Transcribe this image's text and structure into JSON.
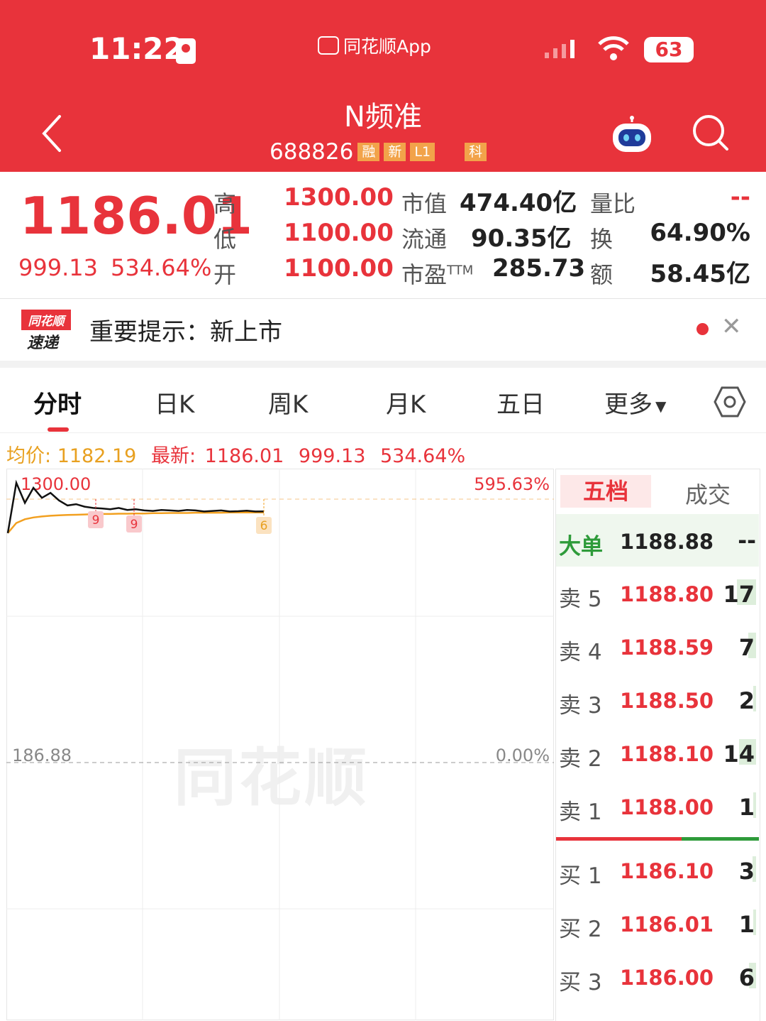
{
  "status_bar": {
    "time": "11:22",
    "app_label": "同花顺App",
    "battery": "63"
  },
  "header": {
    "stock_name": "N频准",
    "stock_code": "688826",
    "tags": [
      "融",
      "新",
      "L1",
      "科"
    ]
  },
  "quote": {
    "price": "1186.01",
    "change": "999.13",
    "change_pct": "534.64%",
    "high_label": "高",
    "high": "1300.00",
    "low_label": "低",
    "low": "1100.00",
    "open_label": "开",
    "open": "1100.00",
    "mcap_label": "市值",
    "mcap": "474.40亿",
    "float_label": "流通",
    "float_cap": "90.35亿",
    "pe_label": "市盈",
    "pe_sup": "TTM",
    "pe": "285.73",
    "vol_ratio_label": "量比",
    "vol_ratio": "--",
    "turnover_label": "换",
    "turnover": "64.90%",
    "amount_label": "额",
    "amount": "58.45亿"
  },
  "notice": {
    "logo_line1": "同花顺",
    "logo_line2": "速递",
    "text": "重要提示：新上市"
  },
  "tabs": [
    "分时",
    "日K",
    "周K",
    "月K",
    "五日",
    "更多"
  ],
  "info_line": {
    "avg_label": "均价:",
    "avg": "1182.19",
    "latest_label": "最新:",
    "latest": "1186.01",
    "change": "999.13",
    "change_pct": "534.64%"
  },
  "chart_data": {
    "type": "line",
    "series": [
      {
        "values": [
          1100,
          1300,
          1220,
          1280,
          1240,
          1260,
          1230,
          1210,
          1215,
          1205,
          1200,
          1198,
          1195,
          1200,
          1192,
          1195,
          1190,
          1188,
          1192,
          1190,
          1188,
          1192,
          1190,
          1186,
          1188,
          1190,
          1186,
          1187,
          1189,
          1186,
          1186.01
        ]
      },
      {
        "values": [
          1100,
          1140,
          1155,
          1162,
          1166,
          1169,
          1171,
          1172,
          1173,
          1174,
          1175,
          1176,
          1176,
          1177,
          1177,
          1178,
          1178,
          1179,
          1179,
          1180,
          1180,
          1180,
          1181,
          1181,
          1181,
          1181,
          1182,
          1182,
          1182,
          1182,
          1182.19
        ]
      }
    ],
    "y_top_label": "1300.00",
    "y_mid_label": "186.88",
    "pct_top_label": "595.63%",
    "pct_mid_label": "0.00%",
    "markers": [
      "9",
      "9",
      "6"
    ],
    "watermark": "同花顺",
    "colors": {
      "price": "#111111",
      "avg": "#F2A020",
      "high_segment": "#E8333B"
    }
  },
  "orderbook": {
    "tab_active": "五档",
    "tab_other": "成交",
    "big_order_label": "大单",
    "big_order_price": "1188.88",
    "big_order_vol": "--",
    "asks": [
      {
        "label": "卖 5",
        "price": "1188.80",
        "vol": "17",
        "bar_pct": 45
      },
      {
        "label": "卖 4",
        "price": "1188.59",
        "vol": "7",
        "bar_pct": 18
      },
      {
        "label": "卖 3",
        "price": "1188.50",
        "vol": "2",
        "bar_pct": 6
      },
      {
        "label": "卖 2",
        "price": "1188.10",
        "vol": "14",
        "bar_pct": 40
      },
      {
        "label": "卖 1",
        "price": "1188.00",
        "vol": "1",
        "bar_pct": 3
      }
    ],
    "bids": [
      {
        "label": "买 1",
        "price": "1186.10",
        "vol": "3",
        "bar_pct": 8
      },
      {
        "label": "买 2",
        "price": "1186.01",
        "vol": "1",
        "bar_pct": 3
      },
      {
        "label": "买 3",
        "price": "1186.00",
        "vol": "6",
        "bar_pct": 16
      }
    ],
    "split_red_fraction": 0.62,
    "colors": {
      "red": "#E8333B",
      "green": "#2E9B3A"
    }
  }
}
